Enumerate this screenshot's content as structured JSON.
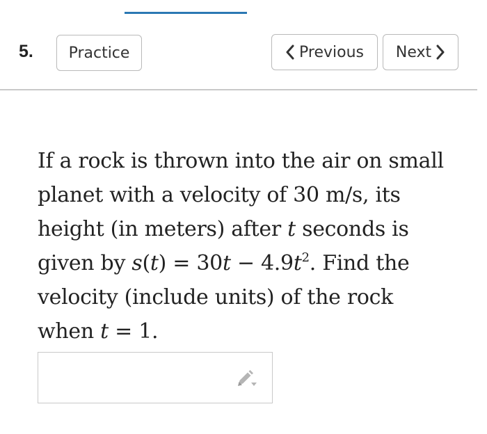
{
  "header": {
    "question_number": "5.",
    "practice_label": "Practice",
    "previous_label": "Previous",
    "next_label": "Next"
  },
  "question": {
    "lines": [
      [
        "If a rock is thrown into the air on small"
      ],
      [
        "planet with a velocity of 30 m/s, its"
      ],
      [
        "height (in meters) after ",
        "t",
        " seconds is"
      ],
      [
        "given by ",
        "s",
        "(",
        "t",
        ") = 30",
        "t",
        " − 4.9",
        "t",
        "2",
        ". Find the"
      ],
      [
        "velocity (include units) of the rock"
      ],
      [
        "when ",
        "t",
        " = 1."
      ]
    ]
  },
  "answer": {
    "value": "",
    "edit_icon": "pencil-dropdown-icon"
  },
  "colors": {
    "accent": "#2b78b3",
    "border": "#b9b9b9",
    "text": "#222222"
  }
}
